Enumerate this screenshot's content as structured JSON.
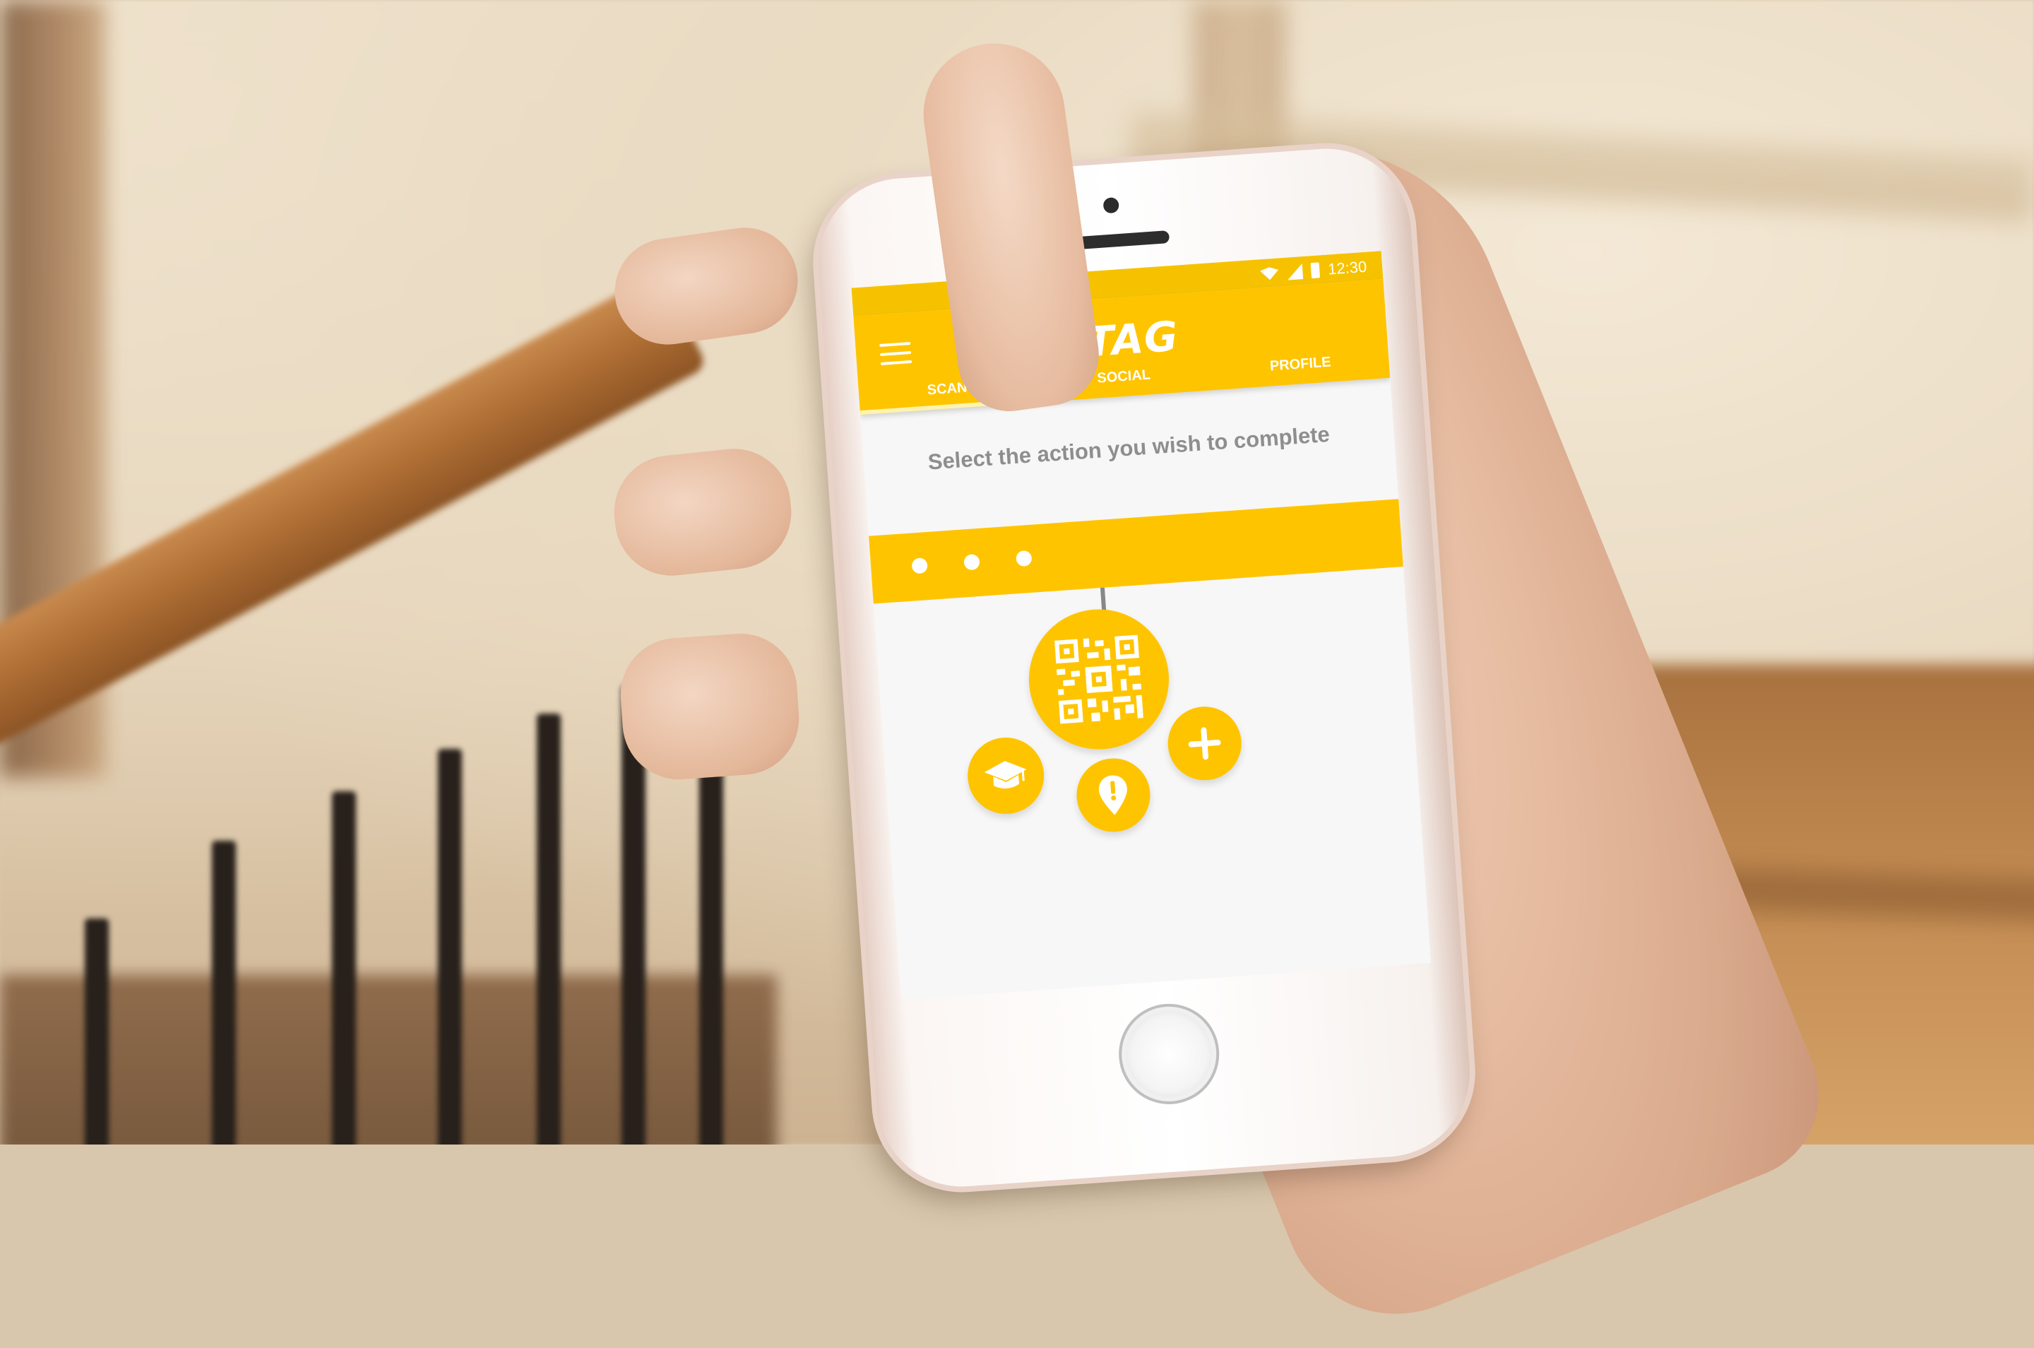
{
  "status_bar": {
    "time": "12:30",
    "icons": [
      "wifi-icon",
      "signal-icon",
      "battery-icon"
    ]
  },
  "app": {
    "title": "WAGTAG",
    "menu_icon": "menu-icon",
    "tabs": [
      {
        "label": "SCAN",
        "active": true
      },
      {
        "label": "SOCIAL",
        "active": false
      },
      {
        "label": "PROFILE",
        "active": false
      }
    ]
  },
  "content": {
    "prompt": "Select the action you wish to complete",
    "progress_steps": 3,
    "actions": [
      {
        "name": "scan-qr",
        "icon": "qr-code-icon"
      },
      {
        "name": "learn",
        "icon": "graduation-cap-icon"
      },
      {
        "name": "report",
        "icon": "alert-marker-icon"
      },
      {
        "name": "add",
        "icon": "plus-icon"
      }
    ]
  },
  "colors": {
    "accent": "#ffc400",
    "status_bar": "#f6c200",
    "text_muted": "#8e8e8e",
    "on_accent": "#ffffff"
  }
}
